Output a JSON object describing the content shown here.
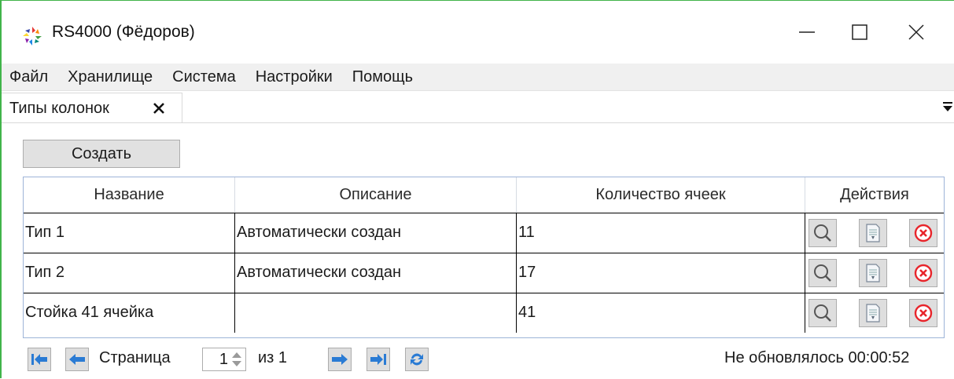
{
  "window": {
    "title": "RS4000 (Фёдоров)",
    "border_color": "#41b44a"
  },
  "menu": {
    "items": [
      "Файл",
      "Хранилище",
      "Система",
      "Настройки",
      "Помощь"
    ]
  },
  "tabs": [
    {
      "label": "Типы колонок",
      "close_icon": "close-icon"
    }
  ],
  "toolbar": {
    "create_label": "Создать"
  },
  "table": {
    "columns": [
      "Название",
      "Описание",
      "Количество ячеек",
      "Действия"
    ],
    "rows": [
      {
        "name": "Тип 1",
        "description": "Автоматически создан",
        "cells": "11"
      },
      {
        "name": "Тип 2",
        "description": "Автоматически создан",
        "cells": "17"
      },
      {
        "name": "Стойка 41 ячейка",
        "description": "",
        "cells": "41"
      }
    ],
    "row_actions": [
      "view-icon",
      "edit-document-icon",
      "delete-icon"
    ]
  },
  "pager": {
    "page_label": "Страница",
    "page_value": "1",
    "of_label": "из 1",
    "status": "Не обновлялось 00:00:52"
  },
  "colors": {
    "accent_blue": "#2a7bd4",
    "delete_red": "#e8252b",
    "button_face": "#dedede"
  }
}
